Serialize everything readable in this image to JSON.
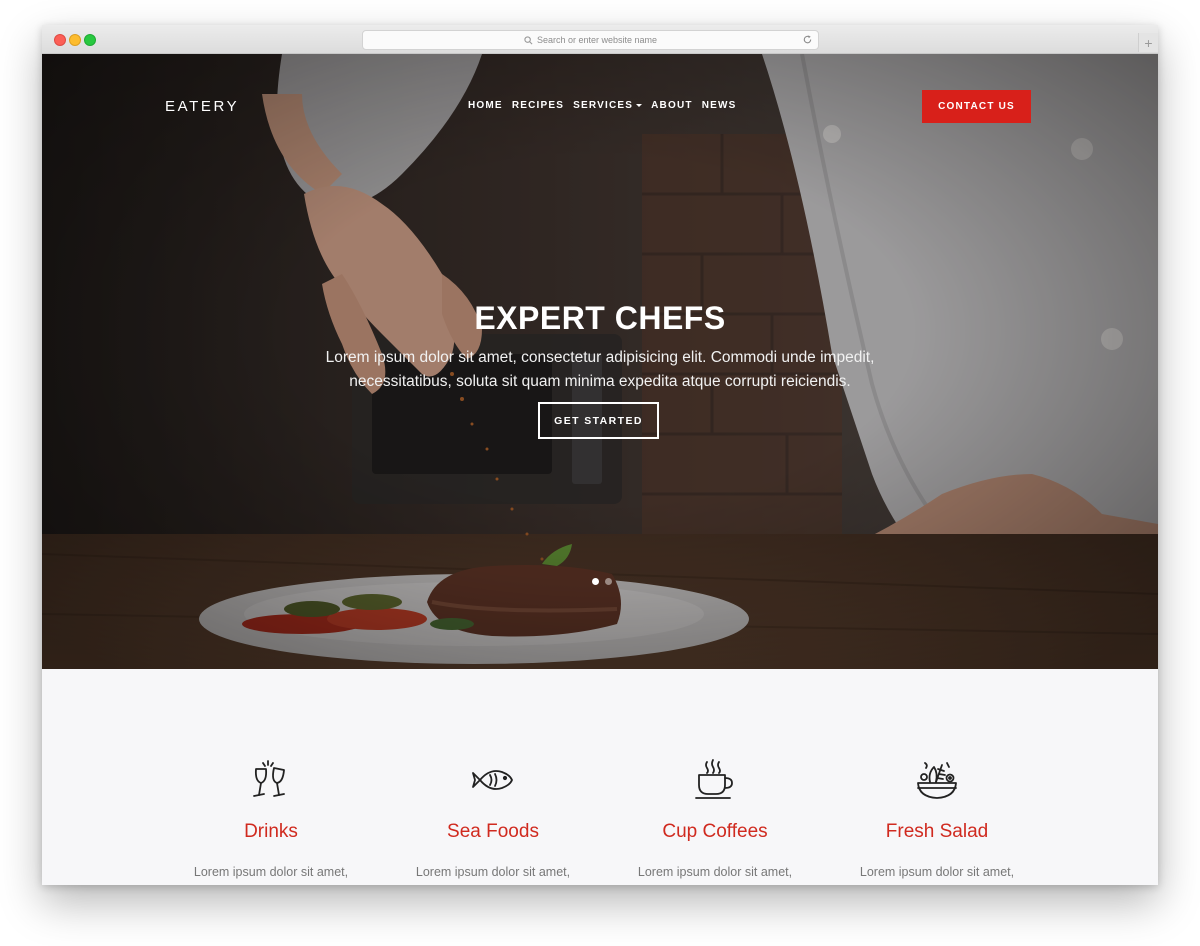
{
  "browser": {
    "url_placeholder": "Search or enter website name",
    "newtab_label": "+"
  },
  "header": {
    "logo": "EATERY",
    "nav": [
      {
        "label": "HOME"
      },
      {
        "label": "RECIPES"
      },
      {
        "label": "SERVICES"
      },
      {
        "label": "ABOUT"
      },
      {
        "label": "NEWS"
      }
    ],
    "contact_label": "CONTACT US"
  },
  "hero": {
    "title": "EXPERT CHEFS",
    "subtitle_line1": "Lorem ipsum dolor sit amet, consectetur adipisicing elit. Commodi unde impedit,",
    "subtitle_line2": "necessitatibus, soluta sit quam minima expedita atque corrupti reiciendis.",
    "cta_label": "GET STARTED",
    "slides_total": 2,
    "active_slide": 1
  },
  "features": [
    {
      "title": "Drinks",
      "text": "Lorem ipsum dolor sit amet,",
      "icon": "wine-glasses-icon"
    },
    {
      "title": "Sea Foods",
      "text": "Lorem ipsum dolor sit amet,",
      "icon": "fish-icon"
    },
    {
      "title": "Cup Coffees",
      "text": "Lorem ipsum dolor sit amet,",
      "icon": "coffee-cup-icon"
    },
    {
      "title": "Fresh Salad",
      "text": "Lorem ipsum dolor sit amet,",
      "icon": "salad-bowl-icon"
    }
  ],
  "colors": {
    "accent": "#d8201a",
    "feature_title": "#d02a1f",
    "section_bg": "#f7f7f9"
  }
}
